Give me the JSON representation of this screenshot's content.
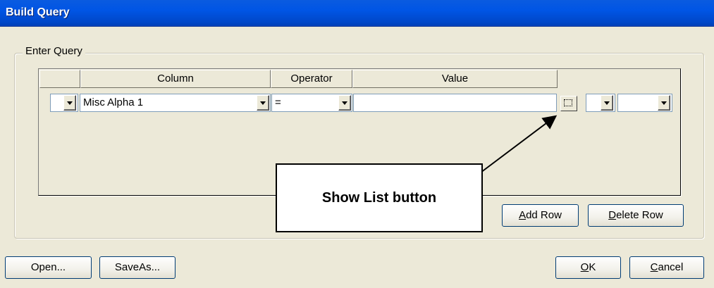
{
  "window": {
    "title": "Build Query"
  },
  "group": {
    "label": "Enter Query"
  },
  "grid": {
    "headers": [
      "Column",
      "Operator",
      "Value"
    ],
    "row": {
      "column_value": "Misc Alpha 1",
      "operator_value": "=",
      "value": ""
    }
  },
  "buttons": {
    "add_row": {
      "mnemonic": "A",
      "rest": "dd Row"
    },
    "delete_row": {
      "mnemonic": "D",
      "rest": "elete Row"
    },
    "open": "Open...",
    "save_as": "SaveAs...",
    "ok": {
      "mnemonic": "O",
      "rest": "K"
    },
    "cancel": {
      "mnemonic": "C",
      "rest": "ancel"
    }
  },
  "callout": {
    "text": "Show List button"
  },
  "icons": {
    "dropdown": "chevron-down-icon",
    "show_list": "show-list-icon"
  }
}
